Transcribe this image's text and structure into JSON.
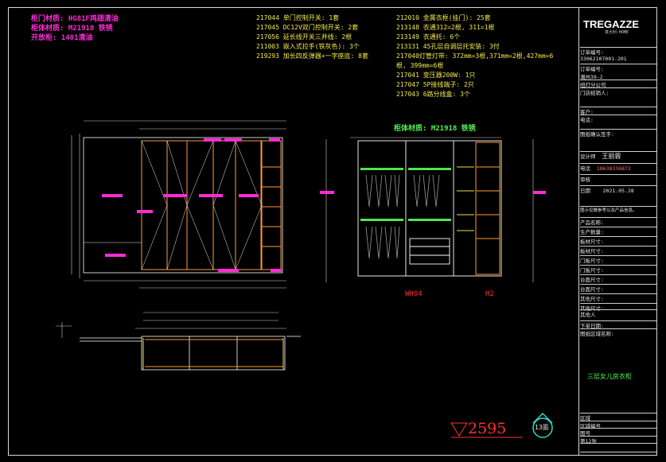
{
  "notes_left": [
    "柜门材质: HG81F鸡翅清油",
    "柜体材质: M21918 铁锈",
    "开放柜: 1401清油"
  ],
  "spec_col1": [
    "217044 单门控制开关: 1套",
    "217045 DC12V双门控制开关: 2套",
    "217056 延长线开关三并线: 2根",
    "211003 嵌入式拉手(铁灰色): 3个",
    "219293 加长四反弹器+一字座底: 8套"
  ],
  "spec_col2": [
    "212010 金属衣框(挂门): 25套",
    "213148 衣通312=2根, 311=1根",
    "213149 衣通托: 6个",
    "213131 45孔层自调层托安装: 3付",
    "217040灯管灯带: 372mm=3根,371mm=2根,427mm=6",
    "根, 399mm=6根",
    "217041 变压器200W: 1只",
    "217047 5P接线端子: 2只",
    "217043 6路分线盒: 3个"
  ],
  "center_label": "柜体材质: M21918 铁锈",
  "red_labels": {
    "left": "WH04",
    "right": "H2"
  },
  "bottom": {
    "number": "2595",
    "badge": "13面"
  },
  "title_block": {
    "logo": "TREGAZZE",
    "logo_sub": "意大利·HOME",
    "order_no_label": "订单编号:",
    "order_no": "33062107001-201",
    "contract_label": "订单编号:",
    "contract": "潮州39-2",
    "shop": "纽灯分公司",
    "shop_label": "门店经销人:",
    "customer_label": "客户:",
    "phone_label": "电话:",
    "address_label": "家庭地址:",
    "sign_label": "图纸确认签字:",
    "designer_label": "设计师",
    "designer": "王丽蓉",
    "tel_label": "电话",
    "tel": "18638336872",
    "review_label": "审核",
    "date_label": "日期",
    "date": "2021.05.28",
    "notice": "图示仅做参考以及产品信息。",
    "rows": [
      "产品名称:",
      "生产数量:",
      "板材尺寸:",
      "板材尺寸:",
      "门板尺寸:",
      "门板尺寸:",
      "台面尺寸:",
      "台面尺寸:",
      "其他尺寸:",
      "其他尺寸:",
      "其他尺寸:",
      "其他尺寸:",
      "其他人",
      "下单日期:",
      "图纸区域名称:"
    ],
    "name_big": "三层女儿房衣柜",
    "foot": [
      "区域",
      "区域编号",
      "图号",
      "第12张"
    ]
  }
}
